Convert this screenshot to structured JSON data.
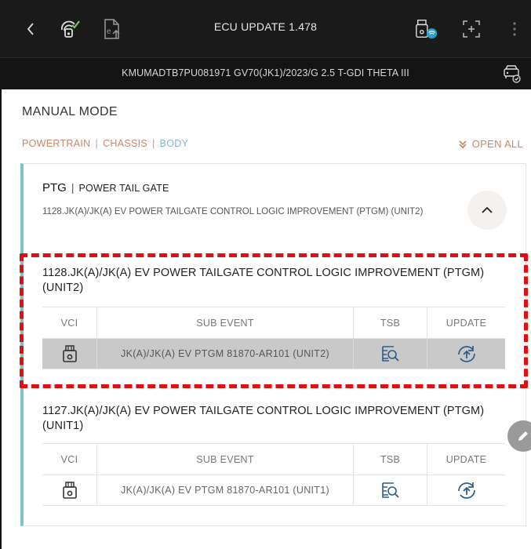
{
  "header": {
    "title": "ECU UPDATE 1.478",
    "back_icon": "chevron-left-icon",
    "icons": [
      "wireless-vci-icon",
      "file-upload-icon",
      "vci-connected-icon",
      "screen-capture-icon",
      "more-vertical-icon"
    ],
    "vehicle_info": "KMUMADTB7PU081971  GV70(JK1)/2023/G 2.5 T-GDI THETA III"
  },
  "page": {
    "mode_title": "MANUAL MODE",
    "filters": [
      "POWERTRAIN",
      "CHASSIS",
      "BODY"
    ],
    "open_all": "OPEN ALL"
  },
  "card": {
    "code": "PTG",
    "name": "POWER TAIL GATE",
    "description": "1128.JK(A)/JK(A) EV POWER TAILGATE CONTROL LOGIC IMPROVEMENT (PTGM) (UNIT2)"
  },
  "table_headers": {
    "vci": "VCI",
    "sub_event": "SUB EVENT",
    "tsb": "TSB",
    "update": "UPDATE"
  },
  "events": [
    {
      "title": "1128.JK(A)/JK(A) EV POWER TAILGATE CONTROL LOGIC IMPROVEMENT (PTGM) (UNIT2)",
      "sub_event": "JK(A)/JK(A) EV PTGM 81870-AR101 (UNIT2)",
      "selected": true
    },
    {
      "title": "1127.JK(A)/JK(A) EV POWER TAILGATE CONTROL LOGIC IMPROVEMENT (PTGM) (UNIT1)",
      "sub_event": "JK(A)/JK(A) EV PTGM 81870-AR101 (UNIT1)",
      "selected": false
    }
  ],
  "colors": {
    "accent": "#c8876a",
    "body_filter": "#7fb4d4",
    "card_border": "#7ec3cc",
    "highlight_dash": "#e01010",
    "topbar": "#1a1a1a"
  }
}
